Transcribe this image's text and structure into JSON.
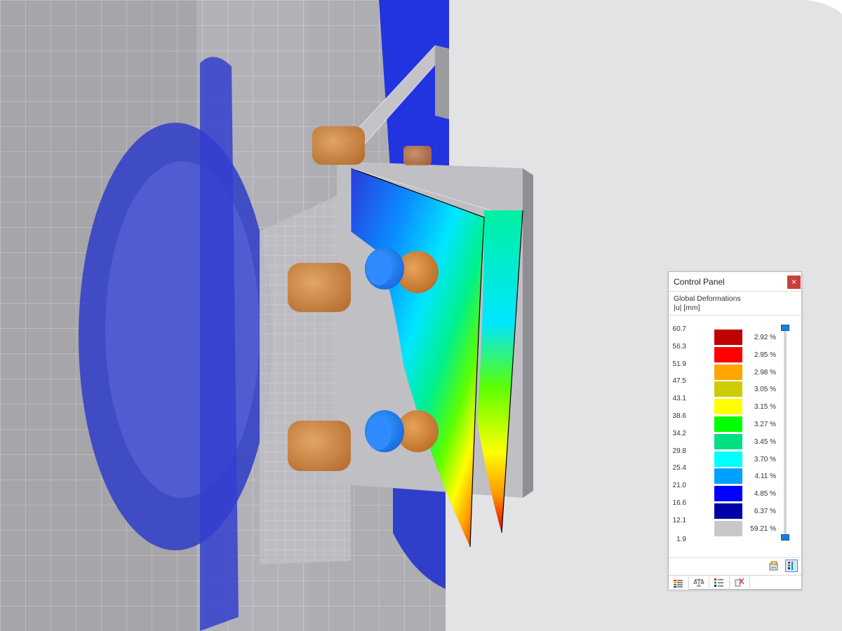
{
  "viewport": {
    "background_color": "#e3e3e6",
    "scene_description_icons": [
      "column-mesh",
      "deformed-plate",
      "bolt"
    ]
  },
  "control_panel": {
    "title": "Control Panel",
    "close_icon": "close-icon",
    "result_type": "Global Deformations",
    "result_unit": "|u| [mm]",
    "legend": [
      {
        "value": "60.7",
        "color": "#c00000",
        "percent": "2.92 %"
      },
      {
        "value": "56.3",
        "color": "#ff0000",
        "percent": "2.95 %"
      },
      {
        "value": "51.9",
        "color": "#ffa500",
        "percent": "2.98 %"
      },
      {
        "value": "47.5",
        "color": "#cccc00",
        "percent": "3.05 %"
      },
      {
        "value": "43.1",
        "color": "#ffff00",
        "percent": "3.15 %"
      },
      {
        "value": "38.6",
        "color": "#00ff00",
        "percent": "3.27 %"
      },
      {
        "value": "34.2",
        "color": "#00e080",
        "percent": "3.45 %"
      },
      {
        "value": "29.8",
        "color": "#00ffff",
        "percent": "3.70 %"
      },
      {
        "value": "25.4",
        "color": "#00a0ff",
        "percent": "4.11 %"
      },
      {
        "value": "21.0",
        "color": "#0000ff",
        "percent": "4.85 %"
      },
      {
        "value": "16.6",
        "color": "#0000a8",
        "percent": "6.37 %"
      },
      {
        "value": "12.1",
        "color": "#c8c8c8",
        "percent": "59.21 %"
      }
    ],
    "legend_min": "1.9",
    "tool_buttons": [
      "export-icon",
      "legend-settings-icon"
    ],
    "tabs": [
      "color-scale-icon",
      "balance-icon",
      "list-icon",
      "filter-icon"
    ]
  }
}
